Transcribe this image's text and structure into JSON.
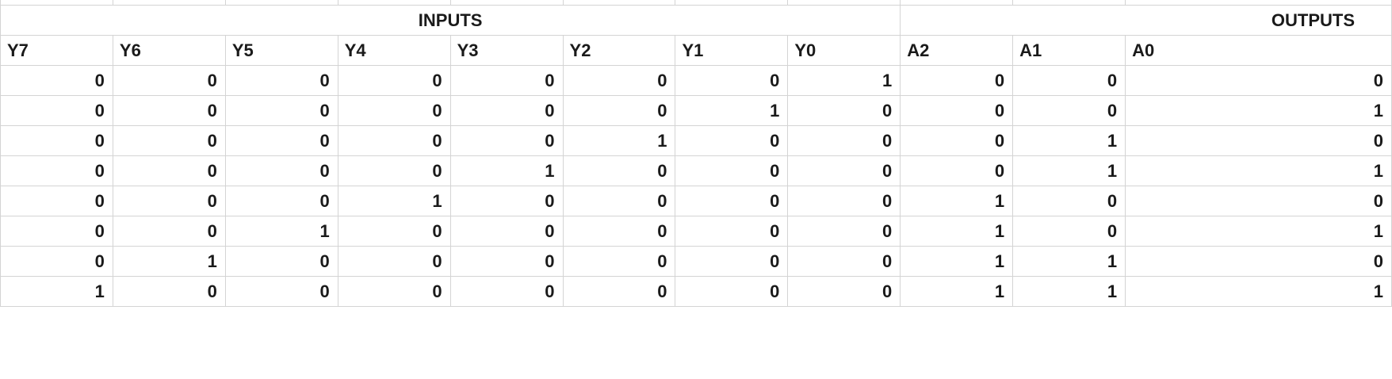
{
  "sheet": {
    "groups": {
      "inputs": "INPUTS",
      "outputs": "OUTPUTS"
    },
    "headers": [
      "Y7",
      "Y6",
      "Y5",
      "Y4",
      "Y3",
      "Y2",
      "Y1",
      "Y0",
      "A2",
      "A1",
      "A0"
    ],
    "rows": [
      [
        0,
        0,
        0,
        0,
        0,
        0,
        0,
        1,
        0,
        0,
        0
      ],
      [
        0,
        0,
        0,
        0,
        0,
        0,
        1,
        0,
        0,
        0,
        1
      ],
      [
        0,
        0,
        0,
        0,
        0,
        1,
        0,
        0,
        0,
        1,
        0
      ],
      [
        0,
        0,
        0,
        0,
        1,
        0,
        0,
        0,
        0,
        1,
        1
      ],
      [
        0,
        0,
        0,
        1,
        0,
        0,
        0,
        0,
        1,
        0,
        0
      ],
      [
        0,
        0,
        1,
        0,
        0,
        0,
        0,
        0,
        1,
        0,
        1
      ],
      [
        0,
        1,
        0,
        0,
        0,
        0,
        0,
        0,
        1,
        1,
        0
      ],
      [
        1,
        0,
        0,
        0,
        0,
        0,
        0,
        0,
        1,
        1,
        1
      ]
    ]
  }
}
